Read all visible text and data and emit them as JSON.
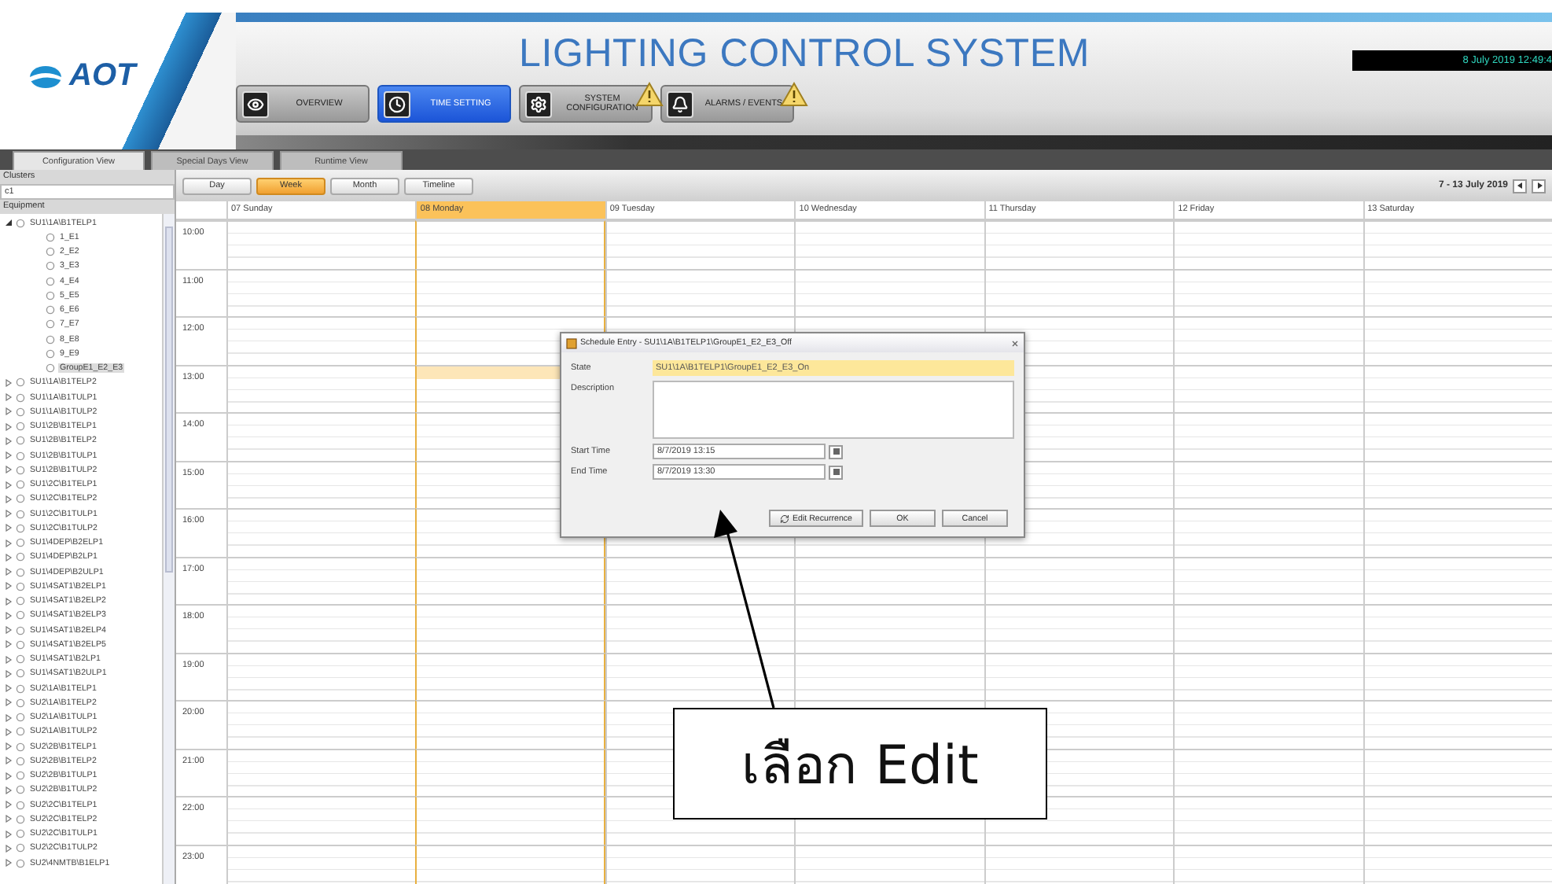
{
  "header": {
    "logo": "AOT",
    "title": "LIGHTING CONTROL SYSTEM",
    "clock": "8 July 2019 12:49:4"
  },
  "nav": [
    {
      "label": "OVERVIEW",
      "selected": false
    },
    {
      "label": "TIME SETTING",
      "selected": true
    },
    {
      "label": "SYSTEM CONFIGURATION",
      "selected": false
    },
    {
      "label": "ALARMS / EVENTS",
      "selected": false
    }
  ],
  "view_tabs": [
    {
      "label": "Configuration View",
      "selected": true
    },
    {
      "label": "Special Days View",
      "selected": false
    },
    {
      "label": "Runtime View",
      "selected": false
    }
  ],
  "sidebar": {
    "clusters_label": "Clusters",
    "cluster_value": "c1",
    "equipment_label": "Equipment",
    "tree": [
      {
        "label": "SU1\\1A\\B1TELP1",
        "expanded": true,
        "selected": false,
        "children": [
          {
            "label": "1_E1",
            "selected": false
          },
          {
            "label": "2_E2",
            "selected": false
          },
          {
            "label": "3_E3",
            "selected": false
          },
          {
            "label": "4_E4",
            "selected": false
          },
          {
            "label": "5_E5",
            "selected": false
          },
          {
            "label": "6_E6",
            "selected": false
          },
          {
            "label": "7_E7",
            "selected": false
          },
          {
            "label": "8_E8",
            "selected": false
          },
          {
            "label": "9_E9",
            "selected": false
          },
          {
            "label": "GroupE1_E2_E3",
            "selected": true
          }
        ]
      },
      {
        "label": "SU1\\1A\\B1TELP2",
        "expanded": false,
        "selected": false
      },
      {
        "label": "SU1\\1A\\B1TULP1",
        "expanded": false,
        "selected": false
      },
      {
        "label": "SU1\\1A\\B1TULP2",
        "expanded": false,
        "selected": false
      },
      {
        "label": "SU1\\2B\\B1TELP1",
        "expanded": false,
        "selected": false
      },
      {
        "label": "SU1\\2B\\B1TELP2",
        "expanded": false,
        "selected": false
      },
      {
        "label": "SU1\\2B\\B1TULP1",
        "expanded": false,
        "selected": false
      },
      {
        "label": "SU1\\2B\\B1TULP2",
        "expanded": false,
        "selected": false
      },
      {
        "label": "SU1\\2C\\B1TELP1",
        "expanded": false,
        "selected": false
      },
      {
        "label": "SU1\\2C\\B1TELP2",
        "expanded": false,
        "selected": false
      },
      {
        "label": "SU1\\2C\\B1TULP1",
        "expanded": false,
        "selected": false
      },
      {
        "label": "SU1\\2C\\B1TULP2",
        "expanded": false,
        "selected": false
      },
      {
        "label": "SU1\\4DEP\\B2ELP1",
        "expanded": false,
        "selected": false
      },
      {
        "label": "SU1\\4DEP\\B2LP1",
        "expanded": false,
        "selected": false
      },
      {
        "label": "SU1\\4DEP\\B2ULP1",
        "expanded": false,
        "selected": false
      },
      {
        "label": "SU1\\4SAT1\\B2ELP1",
        "expanded": false,
        "selected": false
      },
      {
        "label": "SU1\\4SAT1\\B2ELP2",
        "expanded": false,
        "selected": false
      },
      {
        "label": "SU1\\4SAT1\\B2ELP3",
        "expanded": false,
        "selected": false
      },
      {
        "label": "SU1\\4SAT1\\B2ELP4",
        "expanded": false,
        "selected": false
      },
      {
        "label": "SU1\\4SAT1\\B2ELP5",
        "expanded": false,
        "selected": false
      },
      {
        "label": "SU1\\4SAT1\\B2LP1",
        "expanded": false,
        "selected": false
      },
      {
        "label": "SU1\\4SAT1\\B2ULP1",
        "expanded": false,
        "selected": false
      },
      {
        "label": "SU2\\1A\\B1TELP1",
        "expanded": false,
        "selected": false
      },
      {
        "label": "SU2\\1A\\B1TELP2",
        "expanded": false,
        "selected": false
      },
      {
        "label": "SU2\\1A\\B1TULP1",
        "expanded": false,
        "selected": false
      },
      {
        "label": "SU2\\1A\\B1TULP2",
        "expanded": false,
        "selected": false
      },
      {
        "label": "SU2\\2B\\B1TELP1",
        "expanded": false,
        "selected": false
      },
      {
        "label": "SU2\\2B\\B1TELP2",
        "expanded": false,
        "selected": false
      },
      {
        "label": "SU2\\2B\\B1TULP1",
        "expanded": false,
        "selected": false
      },
      {
        "label": "SU2\\2B\\B1TULP2",
        "expanded": false,
        "selected": false
      },
      {
        "label": "SU2\\2C\\B1TELP1",
        "expanded": false,
        "selected": false
      },
      {
        "label": "SU2\\2C\\B1TELP2",
        "expanded": false,
        "selected": false
      },
      {
        "label": "SU2\\2C\\B1TULP1",
        "expanded": false,
        "selected": false
      },
      {
        "label": "SU2\\2C\\B1TULP2",
        "expanded": false,
        "selected": false
      },
      {
        "label": "SU2\\4NMTB\\B1ELP1",
        "expanded": false,
        "selected": false
      }
    ]
  },
  "calendar": {
    "views": [
      {
        "label": "Day",
        "selected": false
      },
      {
        "label": "Week",
        "selected": true
      },
      {
        "label": "Month",
        "selected": false
      },
      {
        "label": "Timeline",
        "selected": false
      }
    ],
    "range": "7 - 13 July 2019",
    "days": [
      {
        "label": "07 Sunday",
        "selected": false,
        "has_entry": false
      },
      {
        "label": "08 Monday",
        "selected": true,
        "has_entry": true
      },
      {
        "label": "09 Tuesday",
        "selected": false,
        "has_entry": false
      },
      {
        "label": "10 Wednesday",
        "selected": false,
        "has_entry": false
      },
      {
        "label": "11 Thursday",
        "selected": false,
        "has_entry": false
      },
      {
        "label": "12 Friday",
        "selected": false,
        "has_entry": false
      },
      {
        "label": "13 Saturday",
        "selected": false,
        "has_entry": false
      }
    ],
    "hours": [
      "10:00",
      "11:00",
      "12:00",
      "13:00",
      "14:00",
      "15:00",
      "16:00",
      "17:00",
      "18:00",
      "19:00",
      "20:00",
      "21:00",
      "22:00",
      "23:00"
    ]
  },
  "dialog": {
    "title": "Schedule Entry - SU1\\1A\\B1TELP1\\GroupE1_E2_E3_Off",
    "state_label": "State",
    "state_value": "SU1\\1A\\B1TELP1\\GroupE1_E2_E3_On",
    "description_label": "Description",
    "start_label": "Start Time",
    "start_value": "8/7/2019 13:15",
    "end_label": "End Time",
    "end_value": "8/7/2019 13:30",
    "buttons": [
      "Edit Recurrence",
      "OK",
      "Cancel"
    ]
  },
  "callout": {
    "text": "เลือก Edit"
  }
}
